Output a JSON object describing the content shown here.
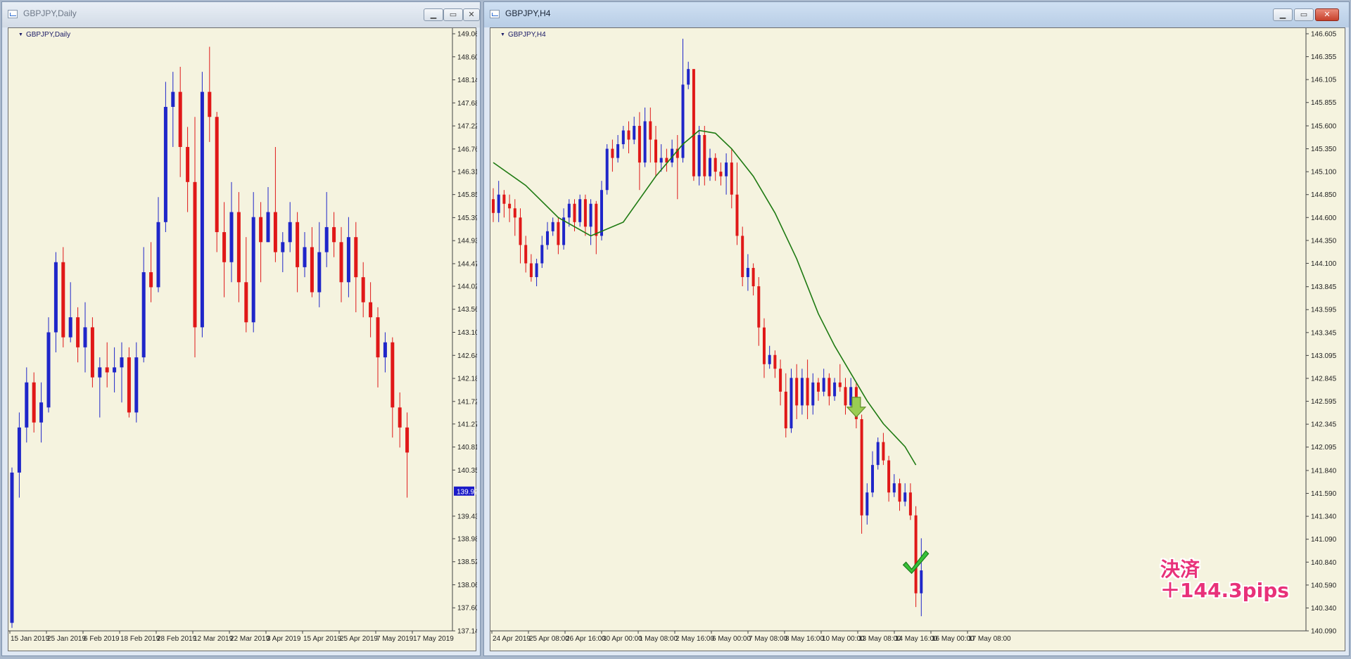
{
  "left_window": {
    "title": "GBPJPY,Daily",
    "symbol_label": "GBPJPY,Daily",
    "buttons": {
      "minimize": "▁",
      "restore": "▭",
      "close": "✕"
    }
  },
  "right_window": {
    "title": "GBPJPY,H4",
    "symbol_label": "GBPJPY,H4",
    "buttons": {
      "minimize": "▁",
      "restore": "▭",
      "close": "✕"
    }
  },
  "annotation": {
    "line1": "決済",
    "line2": "＋144.3pips",
    "check_icon": "check-icon",
    "arrow_icon": "down-arrow-icon"
  },
  "colors": {
    "bull": "#1f26c9",
    "bear": "#e01818",
    "chart_bg": "#f5f3df",
    "ma_line": "#1e7a12",
    "annotation": "#e8317a",
    "current_price_bg": "#1a1ac8"
  },
  "chart_data": [
    {
      "type": "candlestick",
      "symbol": "GBPJPY",
      "timeframe": "Daily",
      "y_ticks": [
        "149.060",
        "148.600",
        "148.140",
        "147.680",
        "147.220",
        "146.760",
        "146.310",
        "145.850",
        "145.390",
        "144.930",
        "144.470",
        "144.020",
        "143.560",
        "143.100",
        "142.640",
        "142.180",
        "141.720",
        "141.270",
        "140.810",
        "140.350",
        "139.430",
        "138.980",
        "138.520",
        "138.060",
        "137.600",
        "137.140"
      ],
      "current_price": "139.923",
      "ylim": [
        137.14,
        149.06
      ],
      "x_tick_labels": [
        "15 Jan 2019",
        "25 Jan 2019",
        "6 Feb 2019",
        "18 Feb 2019",
        "28 Feb 2019",
        "12 Mar 2019",
        "22 Mar 2019",
        "3 Apr 2019",
        "15 Apr 2019",
        "25 Apr 2019",
        "7 May 2019",
        "17 May 2019"
      ],
      "ohlc": [
        [
          137.3,
          140.3,
          137.2,
          140.4
        ],
        [
          140.3,
          141.2,
          139.8,
          141.5
        ],
        [
          141.2,
          142.1,
          140.9,
          142.4
        ],
        [
          142.1,
          141.3,
          141.1,
          142.3
        ],
        [
          141.3,
          141.7,
          140.9,
          142.1
        ],
        [
          141.6,
          143.1,
          141.5,
          143.4
        ],
        [
          143.1,
          144.5,
          142.7,
          144.7
        ],
        [
          144.5,
          143.0,
          142.8,
          144.8
        ],
        [
          143.0,
          143.4,
          142.9,
          144.1
        ],
        [
          143.4,
          142.8,
          142.5,
          143.6
        ],
        [
          142.8,
          143.2,
          142.3,
          143.7
        ],
        [
          143.2,
          142.2,
          142.0,
          143.4
        ],
        [
          142.2,
          142.4,
          141.4,
          142.6
        ],
        [
          142.4,
          142.3,
          142.0,
          142.9
        ],
        [
          142.3,
          142.4,
          141.9,
          142.8
        ],
        [
          142.4,
          142.6,
          141.7,
          142.9
        ],
        [
          142.6,
          141.5,
          141.4,
          142.8
        ],
        [
          141.5,
          142.6,
          141.3,
          142.9
        ],
        [
          142.6,
          144.3,
          142.5,
          144.8
        ],
        [
          144.3,
          144.0,
          143.7,
          144.9
        ],
        [
          144.0,
          145.3,
          143.9,
          145.8
        ],
        [
          145.3,
          147.6,
          145.1,
          148.1
        ],
        [
          147.6,
          147.9,
          146.8,
          148.3
        ],
        [
          147.9,
          146.8,
          146.2,
          148.4
        ],
        [
          146.8,
          146.1,
          145.5,
          147.2
        ],
        [
          146.1,
          143.2,
          142.6,
          147.4
        ],
        [
          143.2,
          147.9,
          143.0,
          148.3
        ],
        [
          147.9,
          147.4,
          146.9,
          148.8
        ],
        [
          147.4,
          145.1,
          144.7,
          147.5
        ],
        [
          145.1,
          144.5,
          143.8,
          145.7
        ],
        [
          144.5,
          145.5,
          144.1,
          146.1
        ],
        [
          145.5,
          144.1,
          143.7,
          145.9
        ],
        [
          144.1,
          143.3,
          143.1,
          145.0
        ],
        [
          143.3,
          145.4,
          143.1,
          145.9
        ],
        [
          145.4,
          144.9,
          144.1,
          145.7
        ],
        [
          144.9,
          145.5,
          144.9,
          146.0
        ],
        [
          145.5,
          144.7,
          144.5,
          146.8
        ],
        [
          144.7,
          144.9,
          144.3,
          145.1
        ],
        [
          144.9,
          145.3,
          144.7,
          145.7
        ],
        [
          145.3,
          144.4,
          143.9,
          145.5
        ],
        [
          144.4,
          144.8,
          144.2,
          145.1
        ],
        [
          144.8,
          143.9,
          143.8,
          145.2
        ],
        [
          143.9,
          144.7,
          143.6,
          145.3
        ],
        [
          144.7,
          145.2,
          144.4,
          145.9
        ],
        [
          145.2,
          144.9,
          144.6,
          145.5
        ],
        [
          144.9,
          144.1,
          143.7,
          145.2
        ],
        [
          144.1,
          145.0,
          143.8,
          145.4
        ],
        [
          145.0,
          144.2,
          143.5,
          145.3
        ],
        [
          144.2,
          143.7,
          143.4,
          144.5
        ],
        [
          143.7,
          143.4,
          143.0,
          144.1
        ],
        [
          143.4,
          142.6,
          142.0,
          143.6
        ],
        [
          142.6,
          142.9,
          142.3,
          143.1
        ],
        [
          142.9,
          141.6,
          141.0,
          143.0
        ],
        [
          141.6,
          141.2,
          140.8,
          141.9
        ],
        [
          141.2,
          140.7,
          139.8,
          141.5
        ]
      ]
    },
    {
      "type": "candlestick",
      "symbol": "GBPJPY",
      "timeframe": "H4",
      "y_ticks": [
        "146.605",
        "146.355",
        "146.105",
        "145.855",
        "145.600",
        "145.350",
        "145.100",
        "144.850",
        "144.600",
        "144.350",
        "144.100",
        "143.845",
        "143.595",
        "143.345",
        "143.095",
        "142.845",
        "142.595",
        "142.345",
        "142.095",
        "141.840",
        "141.590",
        "141.340",
        "141.090",
        "140.840",
        "140.590",
        "140.340",
        "140.090"
      ],
      "ylim": [
        140.09,
        146.605
      ],
      "x_tick_labels": [
        "24 Apr 2019",
        "25 Apr 08:00",
        "26 Apr 16:00",
        "30 Apr 00:00",
        "1 May 08:00",
        "2 May 16:00",
        "6 May 00:00",
        "7 May 08:00",
        "8 May 16:00",
        "10 May 00:00",
        "13 May 08:00",
        "14 May 16:00",
        "16 May 00:00",
        "17 May 08:00"
      ],
      "ohlc": [
        [
          144.8,
          144.65,
          144.55,
          144.92
        ],
        [
          144.65,
          144.85,
          144.55,
          145.0
        ],
        [
          144.85,
          144.75,
          144.6,
          144.9
        ],
        [
          144.75,
          144.7,
          144.55,
          144.85
        ],
        [
          144.7,
          144.6,
          144.4,
          144.8
        ],
        [
          144.6,
          144.3,
          144.1,
          144.7
        ],
        [
          144.3,
          144.1,
          144.0,
          144.4
        ],
        [
          144.1,
          143.95,
          143.9,
          144.2
        ],
        [
          143.95,
          144.1,
          143.85,
          144.15
        ],
        [
          144.1,
          144.3,
          144.05,
          144.4
        ],
        [
          144.3,
          144.45,
          144.25,
          144.55
        ],
        [
          144.45,
          144.55,
          144.4,
          144.6
        ],
        [
          144.55,
          144.3,
          144.2,
          144.6
        ],
        [
          144.3,
          144.6,
          144.25,
          144.7
        ],
        [
          144.6,
          144.75,
          144.5,
          144.8
        ],
        [
          144.75,
          144.55,
          144.45,
          144.8
        ],
        [
          144.55,
          144.8,
          144.5,
          144.85
        ],
        [
          144.8,
          144.5,
          144.4,
          144.85
        ],
        [
          144.5,
          144.75,
          144.3,
          144.8
        ],
        [
          144.75,
          144.4,
          144.2,
          144.78
        ],
        [
          144.4,
          144.9,
          144.35,
          145.0
        ],
        [
          144.9,
          145.35,
          144.85,
          145.4
        ],
        [
          145.35,
          145.25,
          145.1,
          145.45
        ],
        [
          145.25,
          145.4,
          145.2,
          145.5
        ],
        [
          145.4,
          145.55,
          145.35,
          145.6
        ],
        [
          145.55,
          145.45,
          145.3,
          145.65
        ],
        [
          145.45,
          145.6,
          145.4,
          145.7
        ],
        [
          145.6,
          145.2,
          144.9,
          145.75
        ],
        [
          145.2,
          145.65,
          145.15,
          145.8
        ],
        [
          145.65,
          145.45,
          145.2,
          145.8
        ],
        [
          145.45,
          145.2,
          145.05,
          145.6
        ],
        [
          145.2,
          145.25,
          145.1,
          145.4
        ],
        [
          145.25,
          145.2,
          145.1,
          145.35
        ],
        [
          145.2,
          145.35,
          145.15,
          145.45
        ],
        [
          145.35,
          145.25,
          144.8,
          145.5
        ],
        [
          145.25,
          146.05,
          145.2,
          146.55
        ],
        [
          146.05,
          146.22,
          146.0,
          146.3
        ],
        [
          146.22,
          145.05,
          145.0,
          146.15
        ],
        [
          145.05,
          145.5,
          144.95,
          145.6
        ],
        [
          145.5,
          145.05,
          144.95,
          145.6
        ],
        [
          145.05,
          145.25,
          145.0,
          145.35
        ],
        [
          145.25,
          145.1,
          145.0,
          145.3
        ],
        [
          145.1,
          145.05,
          144.95,
          145.2
        ],
        [
          145.05,
          145.2,
          144.85,
          145.3
        ],
        [
          145.2,
          144.85,
          144.7,
          145.35
        ],
        [
          144.85,
          144.4,
          144.3,
          145.2
        ],
        [
          144.4,
          143.95,
          143.85,
          144.5
        ],
        [
          143.95,
          144.05,
          143.8,
          144.2
        ],
        [
          144.05,
          143.85,
          143.75,
          144.1
        ],
        [
          143.85,
          143.4,
          143.2,
          143.95
        ],
        [
          143.4,
          143.0,
          142.85,
          143.5
        ],
        [
          143.0,
          143.1,
          142.95,
          143.2
        ],
        [
          143.1,
          142.95,
          142.85,
          143.15
        ],
        [
          142.95,
          142.7,
          142.55,
          143.05
        ],
        [
          142.7,
          142.3,
          142.2,
          142.9
        ],
        [
          142.3,
          142.85,
          142.25,
          142.95
        ],
        [
          142.85,
          142.55,
          142.4,
          143.0
        ],
        [
          142.55,
          142.85,
          142.45,
          142.95
        ],
        [
          142.85,
          142.55,
          142.4,
          143.05
        ],
        [
          142.55,
          142.8,
          142.45,
          142.9
        ],
        [
          142.8,
          142.7,
          142.6,
          142.85
        ],
        [
          142.7,
          142.85,
          142.65,
          142.95
        ],
        [
          142.85,
          142.65,
          142.55,
          142.9
        ],
        [
          142.65,
          142.8,
          142.6,
          142.85
        ],
        [
          142.8,
          142.75,
          142.7,
          143.0
        ],
        [
          142.75,
          142.55,
          142.45,
          142.85
        ],
        [
          142.55,
          142.75,
          142.5,
          142.85
        ],
        [
          142.75,
          142.4,
          142.3,
          142.8
        ],
        [
          142.4,
          141.35,
          141.15,
          142.45
        ],
        [
          141.35,
          141.6,
          141.25,
          141.7
        ],
        [
          141.6,
          141.9,
          141.55,
          142.05
        ],
        [
          141.9,
          142.15,
          141.85,
          142.2
        ],
        [
          142.15,
          141.95,
          141.9,
          142.25
        ],
        [
          141.95,
          141.6,
          141.5,
          142.0
        ],
        [
          141.6,
          141.7,
          141.55,
          141.8
        ],
        [
          141.7,
          141.5,
          141.4,
          141.75
        ],
        [
          141.5,
          141.6,
          141.45,
          141.7
        ],
        [
          141.6,
          141.35,
          141.3,
          141.7
        ],
        [
          141.35,
          140.5,
          140.35,
          141.45
        ],
        [
          140.5,
          140.75,
          140.25,
          141.1
        ]
      ],
      "ma_line": [
        [
          0,
          145.2
        ],
        [
          6,
          144.95
        ],
        [
          12,
          144.6
        ],
        [
          18,
          144.4
        ],
        [
          24,
          144.55
        ],
        [
          30,
          145.05
        ],
        [
          35,
          145.4
        ],
        [
          38,
          145.55
        ],
        [
          41,
          145.52
        ],
        [
          44,
          145.35
        ],
        [
          48,
          145.05
        ],
        [
          52,
          144.65
        ],
        [
          56,
          144.15
        ],
        [
          60,
          143.55
        ],
        [
          63,
          143.2
        ],
        [
          66,
          142.9
        ],
        [
          69,
          142.6
        ],
        [
          72,
          142.35
        ],
        [
          76,
          142.1
        ],
        [
          78,
          141.9
        ]
      ]
    }
  ]
}
